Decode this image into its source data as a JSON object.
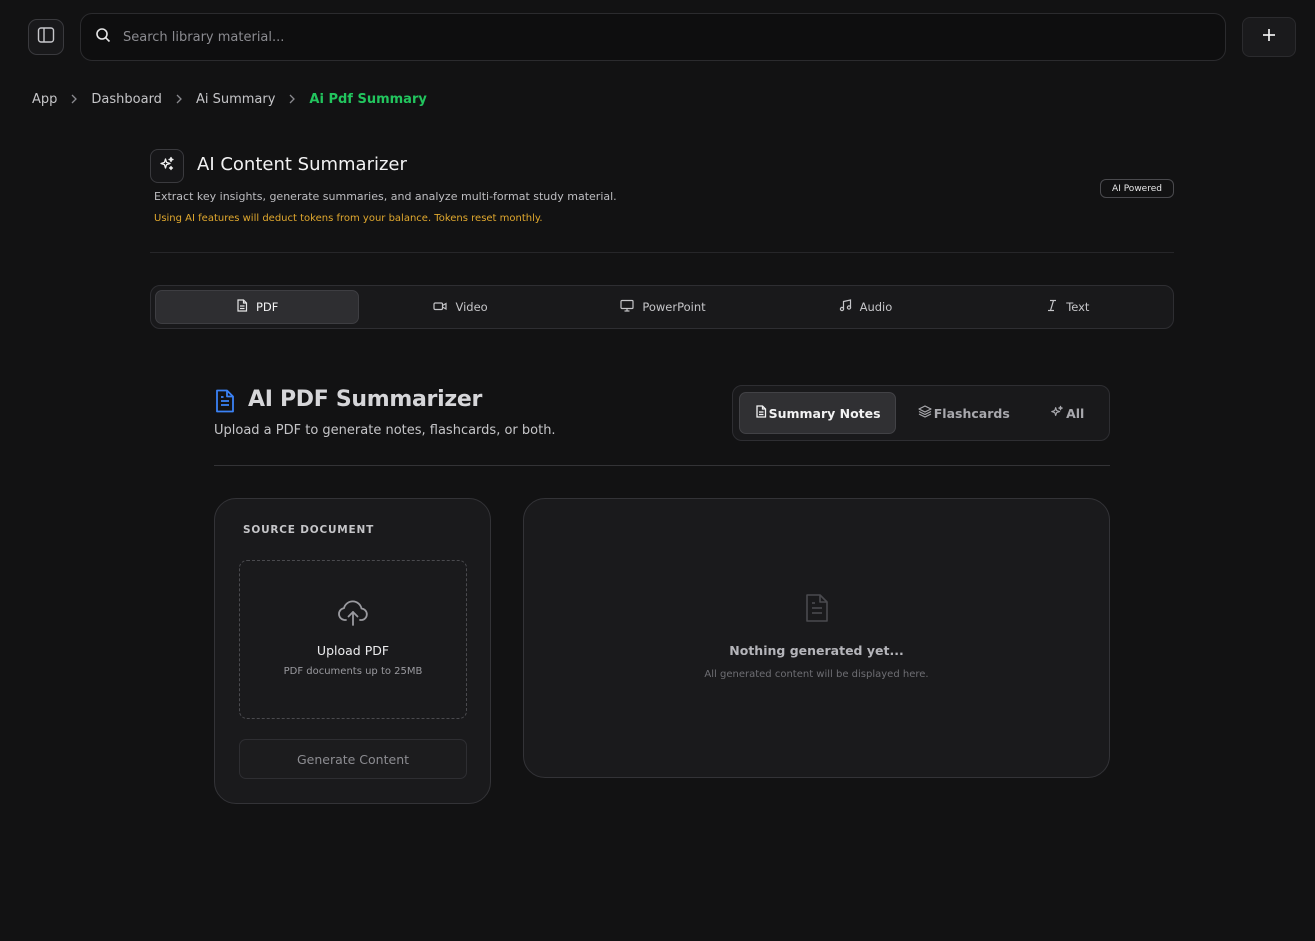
{
  "topbar": {
    "search_placeholder": "Search library material...",
    "sidebar_toggle_icon": "sidebar-icon",
    "new_button_icon": "plus-icon"
  },
  "breadcrumb": {
    "items": [
      "App",
      "Dashboard",
      "Ai Summary",
      "Ai Pdf Summary"
    ],
    "active_color": "#22c55e"
  },
  "header": {
    "title": "AI Content Summarizer",
    "description": "Extract key insights, generate summaries, and analyze multi-format study material.",
    "warning": "Using AI features will deduct tokens from your balance. Tokens reset monthly.",
    "badge": "AI Powered",
    "icon": "sparkles-icon"
  },
  "format_tabs": [
    {
      "label": "PDF",
      "icon": "file-text-icon",
      "active": true
    },
    {
      "label": "Video",
      "icon": "video-icon",
      "active": false
    },
    {
      "label": "PowerPoint",
      "icon": "presentation-icon",
      "active": false
    },
    {
      "label": "Audio",
      "icon": "music-icon",
      "active": false
    },
    {
      "label": "Text",
      "icon": "italic-text-icon",
      "active": false
    }
  ],
  "summarizer": {
    "title": "AI PDF Summarizer",
    "subtitle": "Upload a PDF to generate notes, flashcards, or both.",
    "icon_color": "#3b82f6",
    "modes": [
      {
        "label": "Summary Notes",
        "icon": "file-text-icon",
        "active": true
      },
      {
        "label": "Flashcards",
        "icon": "layers-icon",
        "active": false
      },
      {
        "label": "All",
        "icon": "sparkles-icon",
        "active": false
      }
    ]
  },
  "source": {
    "label": "SOURCE DOCUMENT",
    "upload_title": "Upload PDF",
    "upload_sub": "PDF documents up to 25MB",
    "generate_label": "Generate Content"
  },
  "output": {
    "empty_title": "Nothing generated yet...",
    "empty_sub": "All generated content will be displayed here."
  },
  "colors": {
    "background": "#121213",
    "warning": "#e0a82e"
  }
}
